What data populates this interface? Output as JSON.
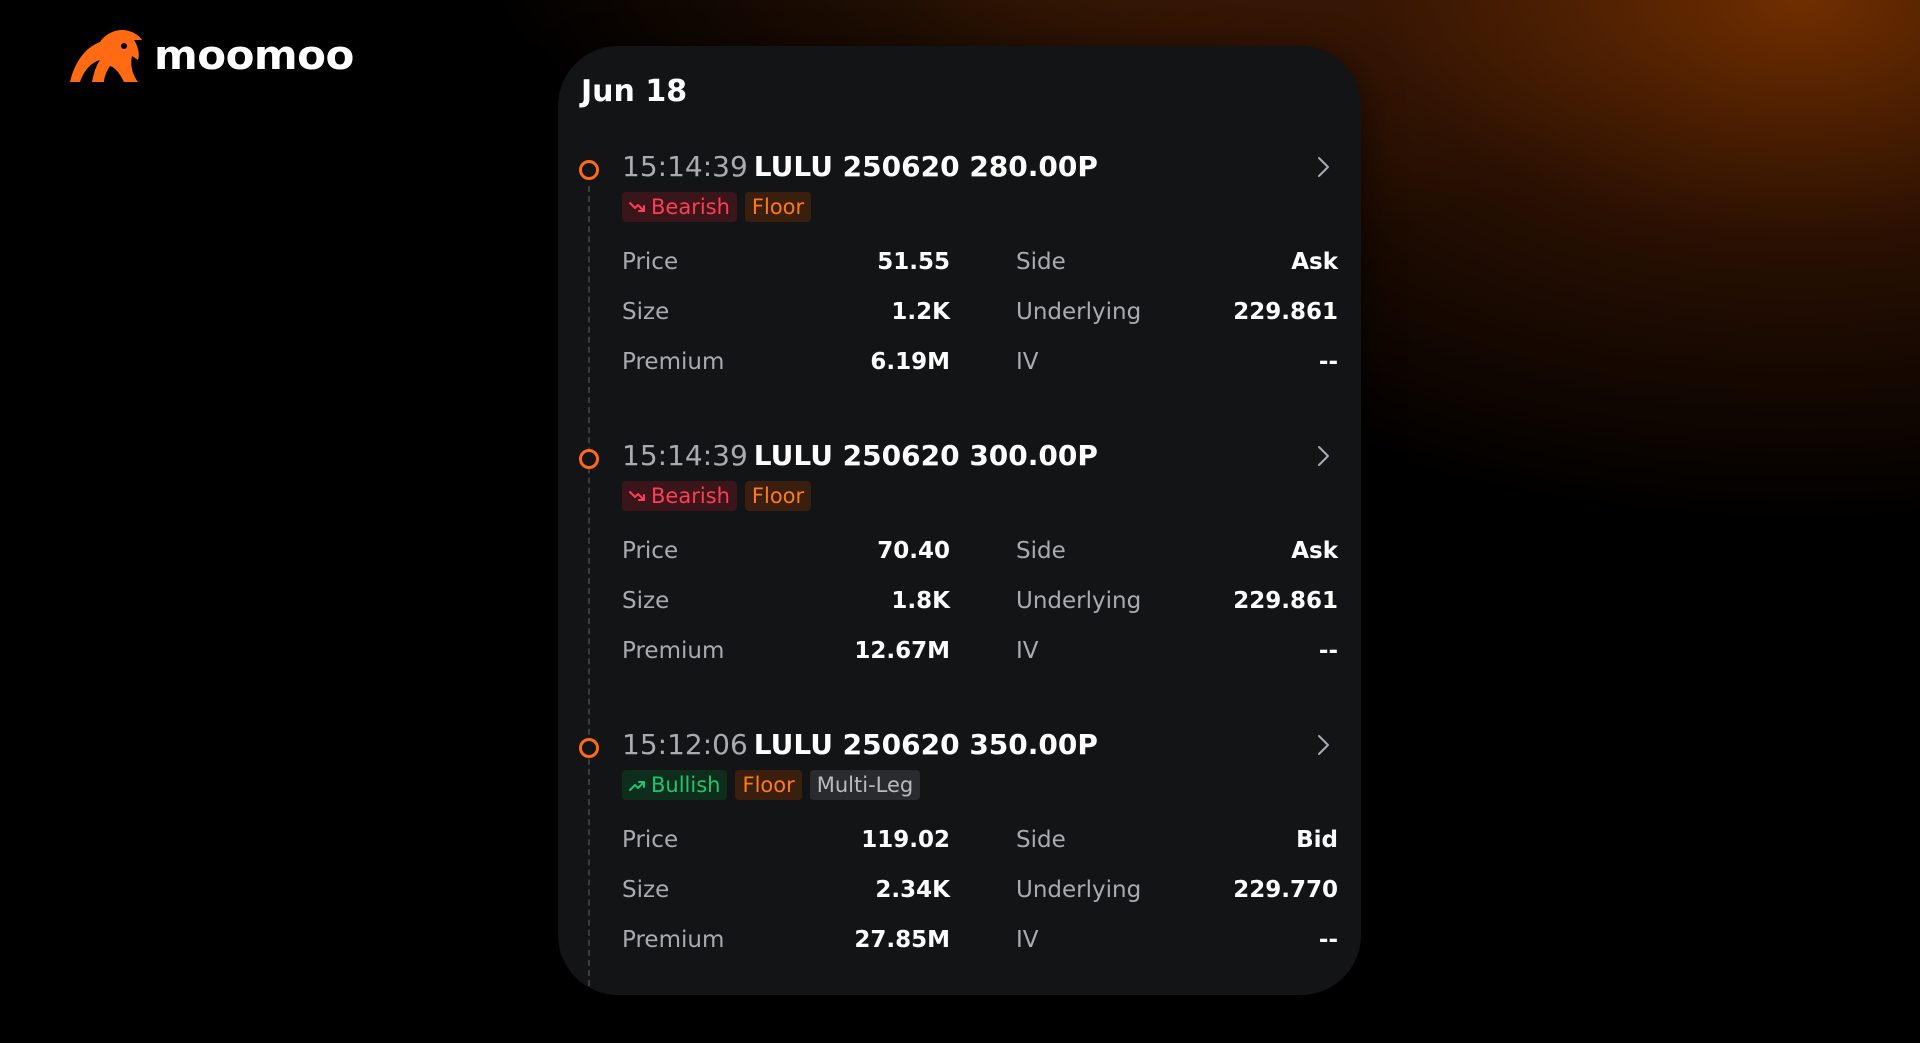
{
  "brand": {
    "name": "moomoo",
    "accent": "#ff6a13",
    "logo_icon": "bull-icon"
  },
  "card": {
    "date": "Jun 18",
    "bearish_color": "#ff3d57",
    "bullish_color": "#1ec66b",
    "floor_color": "#ff7a1a",
    "trades": [
      {
        "time": "15:14:39",
        "symbol": "LULU 250620 280.00P",
        "sentiment": "Bearish",
        "sentiment_icon": "trend-down-icon",
        "tag_floor": "Floor",
        "tag_extra": "",
        "price_label": "Price",
        "price": "51.55",
        "side_label": "Side",
        "side": "Ask",
        "size_label": "Size",
        "size": "1.2K",
        "underlying_label": "Underlying",
        "underlying": "229.861",
        "premium_label": "Premium",
        "premium": "6.19M",
        "iv_label": "IV",
        "iv": "--"
      },
      {
        "time": "15:14:39",
        "symbol": "LULU 250620 300.00P",
        "sentiment": "Bearish",
        "sentiment_icon": "trend-down-icon",
        "tag_floor": "Floor",
        "tag_extra": "",
        "price_label": "Price",
        "price": "70.40",
        "side_label": "Side",
        "side": "Ask",
        "size_label": "Size",
        "size": "1.8K",
        "underlying_label": "Underlying",
        "underlying": "229.861",
        "premium_label": "Premium",
        "premium": "12.67M",
        "iv_label": "IV",
        "iv": "--"
      },
      {
        "time": "15:12:06",
        "symbol": "LULU 250620 350.00P",
        "sentiment": "Bullish",
        "sentiment_icon": "trend-up-icon",
        "tag_floor": "Floor",
        "tag_extra": "Multi-Leg",
        "price_label": "Price",
        "price": "119.02",
        "side_label": "Side",
        "side": "Bid",
        "size_label": "Size",
        "size": "2.34K",
        "underlying_label": "Underlying",
        "underlying": "229.770",
        "premium_label": "Premium",
        "premium": "27.85M",
        "iv_label": "IV",
        "iv": "--"
      }
    ]
  }
}
